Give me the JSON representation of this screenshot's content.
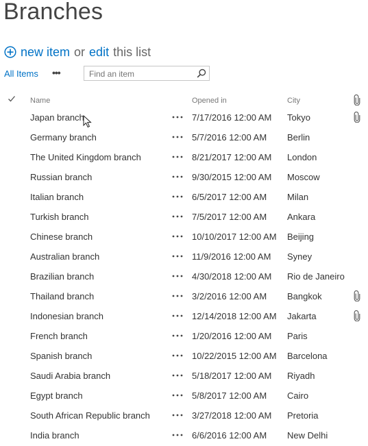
{
  "page": {
    "title": "Branches"
  },
  "command_bar": {
    "new_item": "new item",
    "or": "or",
    "edit": "edit",
    "this_list": "this list"
  },
  "views": {
    "current": "All Items",
    "more": "•••"
  },
  "search": {
    "placeholder": "Find an item"
  },
  "columns": {
    "name": "Name",
    "opened": "Opened in",
    "city": "City"
  },
  "icons": [
    "checkmark-icon",
    "plus-circle-icon",
    "search-icon",
    "more-icon",
    "attachment-icon",
    "mouse-cursor-icon"
  ],
  "colors": {
    "accent": "#0072c6",
    "text": "#333333",
    "muted": "#777777"
  },
  "items": [
    {
      "name": "Japan branch",
      "opened": "7/17/2016 12:00 AM",
      "city": "Tokyo",
      "attachment": true
    },
    {
      "name": "Germany branch",
      "opened": "5/7/2016 12:00 AM",
      "city": "Berlin",
      "attachment": false
    },
    {
      "name": "The United Kingdom branch",
      "opened": "8/21/2017 12:00 AM",
      "city": "London",
      "attachment": false
    },
    {
      "name": "Russian branch",
      "opened": "9/30/2015 12:00 AM",
      "city": "Moscow",
      "attachment": false
    },
    {
      "name": "Italian branch",
      "opened": "6/5/2017 12:00 AM",
      "city": "Milan",
      "attachment": false
    },
    {
      "name": "Turkish branch",
      "opened": "7/5/2017 12:00 AM",
      "city": "Ankara",
      "attachment": false
    },
    {
      "name": "Chinese branch",
      "opened": "10/10/2017 12:00 AM",
      "city": "Beijing",
      "attachment": false
    },
    {
      "name": "Australian branch",
      "opened": "11/9/2016 12:00 AM",
      "city": "Syney",
      "attachment": false
    },
    {
      "name": "Brazilian branch",
      "opened": "4/30/2018 12:00 AM",
      "city": "Rio de Janeiro",
      "attachment": false
    },
    {
      "name": "Thailand branch",
      "opened": "3/2/2016 12:00 AM",
      "city": "Bangkok",
      "attachment": true
    },
    {
      "name": "Indonesian branch",
      "opened": "12/14/2018 12:00 AM",
      "city": "Jakarta",
      "attachment": true
    },
    {
      "name": "French branch",
      "opened": "1/20/2016 12:00 AM",
      "city": "Paris",
      "attachment": false
    },
    {
      "name": "Spanish branch",
      "opened": "10/22/2015 12:00 AM",
      "city": "Barcelona",
      "attachment": false
    },
    {
      "name": "Saudi Arabia branch",
      "opened": "5/18/2017 12:00 AM",
      "city": "Riyadh",
      "attachment": false
    },
    {
      "name": "Egypt branch",
      "opened": "5/8/2017 12:00 AM",
      "city": "Cairo",
      "attachment": false
    },
    {
      "name": "South African Republic branch",
      "opened": "3/27/2018 12:00 AM",
      "city": "Pretoria",
      "attachment": false
    },
    {
      "name": "India branch",
      "opened": "6/6/2016 12:00 AM",
      "city": "New Delhi",
      "attachment": false
    }
  ]
}
